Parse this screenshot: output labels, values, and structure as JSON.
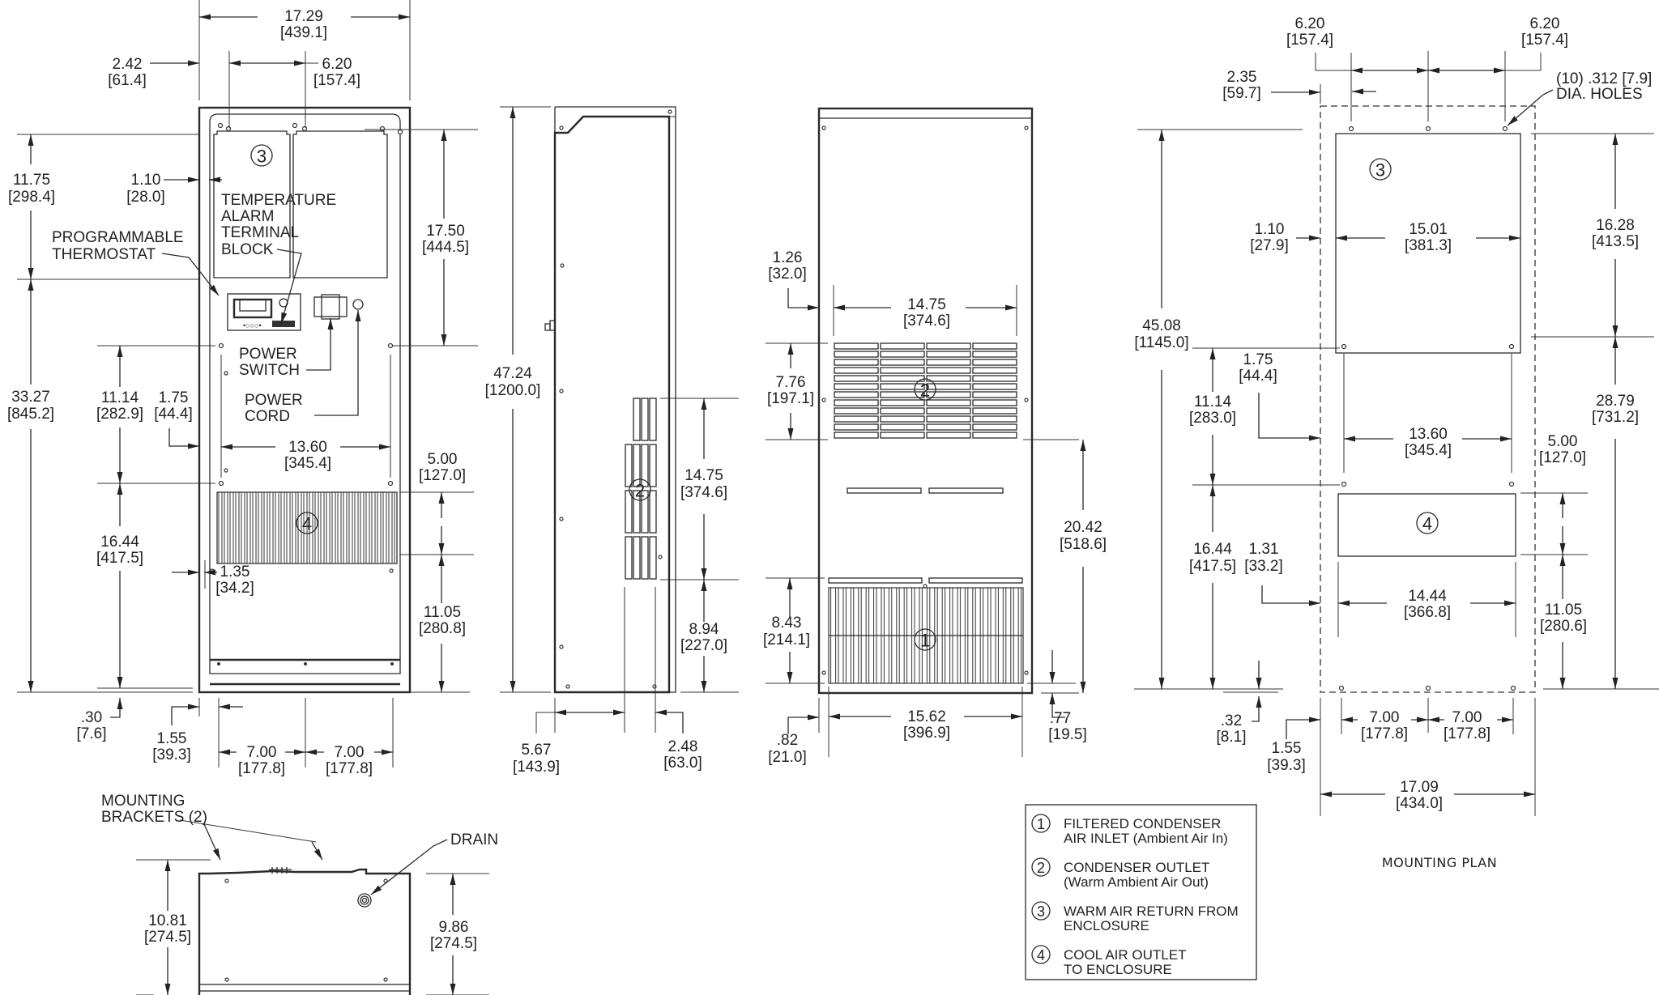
{
  "front_view": {
    "labels": {
      "programmable_thermostat": [
        "PROGRAMMABLE",
        "THERMOSTAT"
      ],
      "temperature_alarm": [
        "TEMPERATURE",
        "ALARM",
        "TERMINAL",
        "BLOCK"
      ],
      "power_switch": [
        "POWER",
        "SWITCH"
      ],
      "power_cord": [
        "POWER",
        "CORD"
      ]
    },
    "callouts": [
      "3",
      "4"
    ],
    "dims": {
      "overall_width": [
        "17.29",
        "[439.1]"
      ],
      "left_offset": [
        "2.42",
        "[61.4]"
      ],
      "hole_spacing_top": [
        "6.20",
        "[157.4]"
      ],
      "return_height": [
        "11.75",
        "[298.4]"
      ],
      "return_inset": [
        "1.10",
        "[28.0]"
      ],
      "right_height": [
        "17.50",
        "[444.5]"
      ],
      "lower_height": [
        "33.27",
        "[845.2]"
      ],
      "hole_vert_a": [
        "11.14",
        "[282.9]"
      ],
      "hole_inset": [
        "1.75",
        "[44.4]"
      ],
      "hole_span": [
        "13.60",
        "[345.4]"
      ],
      "outlet_height": [
        "5.00",
        "[127.0]"
      ],
      "lower_holes": [
        "16.44",
        "[417.5]"
      ],
      "outlet_inset": [
        "1.35",
        "[34.2]"
      ],
      "bottom_to_outlet": [
        "11.05",
        "[280.8]"
      ],
      "bottom_offset": [
        ".30",
        "[7.6]"
      ],
      "bottom_hole_inset": [
        "1.55",
        "[39.3]"
      ],
      "bottom_span_1": [
        "7.00",
        "[177.8]"
      ],
      "bottom_span_2": [
        "7.00",
        "[177.8]"
      ]
    }
  },
  "side_view": {
    "callouts": [
      "2"
    ],
    "dims": {
      "overall_height": [
        "47.24",
        "[1200.0]"
      ],
      "vent_height": [
        "14.75",
        "[374.6]"
      ],
      "vent_bottom": [
        "8.94",
        "[227.0]"
      ],
      "depth_front": [
        "5.67",
        "[143.9]"
      ],
      "depth_rear": [
        "2.48",
        "[63.0]"
      ]
    }
  },
  "back_view": {
    "callouts": [
      "2",
      "1"
    ],
    "dims": {
      "outlet_inset": [
        "1.26",
        "[32.0]"
      ],
      "outlet_width": [
        "14.75",
        "[374.6]"
      ],
      "outlet_height": [
        "7.76",
        "[197.1]"
      ],
      "outlet_to_bottom": [
        "20.42",
        "[518.6]"
      ],
      "inlet_height": [
        "8.43",
        "[214.1]"
      ],
      "inlet_width": [
        "15.62",
        "[396.9]"
      ],
      "inlet_inset": [
        ".82",
        "[21.0]"
      ],
      "inlet_bottom": [
        ".77",
        "[19.5]"
      ]
    }
  },
  "top_view": {
    "labels": {
      "mounting_brackets": [
        "MOUNTING",
        "BRACKETS (2)"
      ],
      "drain": "DRAIN"
    },
    "dims": {
      "overall_depth": [
        "10.81",
        "[274.5]"
      ],
      "body_depth": [
        "9.86",
        "[274.5]"
      ]
    }
  },
  "mounting_plan": {
    "title": "MOUNTING PLAN",
    "hole_note": [
      "(10) .312 [7.9]",
      "DIA. HOLES"
    ],
    "callouts": [
      "3",
      "4"
    ],
    "dims": {
      "top_span_left": [
        "6.20",
        "[157.4]"
      ],
      "top_span_right": [
        "6.20",
        "[157.4]"
      ],
      "left_offset": [
        "2.35",
        "[59.7]"
      ],
      "cutout3_inset": [
        "1.10",
        "[27.9]"
      ],
      "cutout3_width": [
        "15.01",
        "[381.3]"
      ],
      "cutout3_height": [
        "16.28",
        "[413.5]"
      ],
      "overall_height": [
        "45.08",
        "[1145.0]"
      ],
      "hole_inset": [
        "1.75",
        "[44.4]"
      ],
      "hole_vert": [
        "11.14",
        "[283.0]"
      ],
      "hole_span": [
        "13.60",
        "[345.4]"
      ],
      "lower_right": [
        "28.79",
        "[731.2]"
      ],
      "cutout4_height": [
        "5.00",
        "[127.0]"
      ],
      "lower_holes": [
        "16.44",
        "[417.5]"
      ],
      "cutout4_inset": [
        "1.31",
        "[33.2]"
      ],
      "cutout4_width": [
        "14.44",
        "[366.8]"
      ],
      "bottom_to_cutout4": [
        "11.05",
        "[280.6]"
      ],
      "bottom_offset": [
        ".32",
        "[8.1]"
      ],
      "bottom_hole_inset": [
        "1.55",
        "[39.3]"
      ],
      "bottom_span_1": [
        "7.00",
        "[177.8]"
      ],
      "bottom_span_2": [
        "7.00",
        "[177.8]"
      ],
      "overall_width": [
        "17.09",
        "[434.0]"
      ]
    }
  },
  "legend": [
    {
      "num": "1",
      "lines": [
        "FILTERED CONDENSER",
        "AIR INLET (Ambient Air In)"
      ]
    },
    {
      "num": "2",
      "lines": [
        "CONDENSER OUTLET",
        "(Warm Ambient Air Out)"
      ]
    },
    {
      "num": "3",
      "lines": [
        "WARM AIR RETURN FROM",
        "ENCLOSURE"
      ]
    },
    {
      "num": "4",
      "lines": [
        "COOL AIR OUTLET",
        "TO ENCLOSURE"
      ]
    }
  ]
}
